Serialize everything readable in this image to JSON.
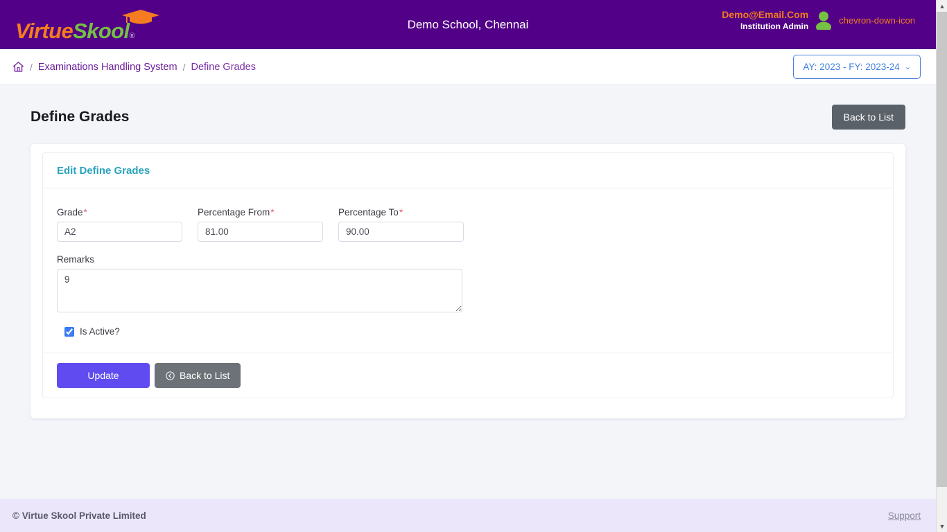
{
  "header": {
    "logo_primary": "Virtue",
    "logo_secondary": "Skool",
    "logo_registered": "®",
    "school_name": "Demo School, Chennai",
    "user_email": "Demo@Email.Com",
    "user_role": "Institution Admin",
    "avatar_icon": "user-avatar-icon",
    "caret_icon": "chevron-down-icon",
    "colors": {
      "bar": "#510087",
      "logo_orange": "#f57c20",
      "logo_green": "#76c043"
    }
  },
  "breadcrumb": {
    "home_icon": "home-icon",
    "separator": "/",
    "items": [
      {
        "label": "Examinations Handling System"
      },
      {
        "label": "Define Grades"
      }
    ],
    "academic_year": {
      "label": "AY: 2023 - FY: 2023-24",
      "chevron": "⌄",
      "color": "#3f7fe0"
    }
  },
  "main": {
    "page_title": "Define Grades",
    "back_to_list_top": "Back to List",
    "card": {
      "title": "Edit Define Grades",
      "title_color": "#2aa3bd",
      "fields": [
        {
          "label": "Grade",
          "required": true,
          "value": "A2"
        },
        {
          "label": "Percentage From",
          "required": true,
          "value": "81.00"
        },
        {
          "label": "Percentage To",
          "required": true,
          "value": "90.00"
        }
      ],
      "remarks": {
        "label": "Remarks",
        "required": false,
        "value": "9"
      },
      "is_active": {
        "label": "Is Active?",
        "checked": true
      },
      "actions": {
        "update": "Update",
        "back_to_list": "Back to List",
        "back_icon": "circle-arrow-left-icon"
      }
    }
  },
  "footer": {
    "copyright": "© Virtue Skool Private Limited",
    "support": "Support"
  },
  "scrollbar": {
    "up_arrow": "chevron-up-icon",
    "down_arrow": "chevron-down-icon"
  }
}
